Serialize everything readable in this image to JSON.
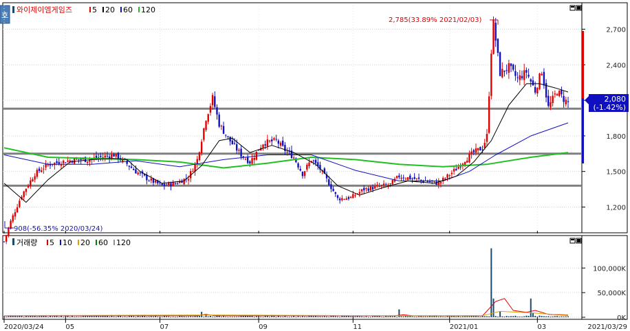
{
  "price_panel": {
    "stock_name": "와이제이엠게임즈",
    "ma_items": [
      {
        "label": "5",
        "color": "#e00000"
      },
      {
        "label": "20",
        "color": "#000000"
      },
      {
        "label": "60",
        "color": "#1010c0"
      },
      {
        "label": "120",
        "color": "#20c020"
      }
    ],
    "max_annotation": "2,785(33.89% 2021/02/03)",
    "min_annotation": "908(-56.35% 2020/03/24)",
    "current_price": "2,080",
    "current_change": "(-1.42%)",
    "side_button": "호"
  },
  "volume_panel": {
    "title": "거래량",
    "ma_items": [
      {
        "label": "5",
        "color": "#e00000"
      },
      {
        "label": "10",
        "color": "#1010c0"
      },
      {
        "label": "20",
        "color": "#e0a000"
      },
      {
        "label": "60",
        "color": "#008000"
      },
      {
        "label": "120",
        "color": "#909090"
      }
    ]
  },
  "colors": {
    "up": "#e00000",
    "down": "#1010c0",
    "ma5": "#e00000",
    "ma20": "#000000",
    "ma60": "#1010c0",
    "ma120": "#20c020",
    "hline": "#808080",
    "volume_bar": "#1a4a6e"
  },
  "chart_data": [
    {
      "type": "candlestick",
      "title": "와이제이엠게임즈",
      "y_ticks": [
        1200,
        1500,
        1800,
        2100,
        2400,
        2700
      ],
      "y_tick_labels": [
        "1,200",
        "1,500",
        "1,800",
        "2,100",
        "2,400",
        "2,700"
      ],
      "ylim": [
        1000,
        2900
      ],
      "x_ticks": [
        "2020/03/24",
        "05",
        "07",
        "09",
        "11",
        "2021/01",
        "03",
        "2021/03/29"
      ],
      "horizontal_lines": [
        2030,
        1650,
        1380
      ],
      "close_trend": [
        {
          "x": 0,
          "y": 908
        },
        {
          "x": 3,
          "y": 1080
        },
        {
          "x": 8,
          "y": 1300
        },
        {
          "x": 14,
          "y": 1480
        },
        {
          "x": 20,
          "y": 1560
        },
        {
          "x": 26,
          "y": 1580
        },
        {
          "x": 32,
          "y": 1600
        },
        {
          "x": 38,
          "y": 1600
        },
        {
          "x": 44,
          "y": 1620
        },
        {
          "x": 50,
          "y": 1640
        },
        {
          "x": 55,
          "y": 1580
        },
        {
          "x": 60,
          "y": 1500
        },
        {
          "x": 66,
          "y": 1430
        },
        {
          "x": 72,
          "y": 1380
        },
        {
          "x": 78,
          "y": 1400
        },
        {
          "x": 84,
          "y": 1450
        },
        {
          "x": 88,
          "y": 1600
        },
        {
          "x": 92,
          "y": 1950
        },
        {
          "x": 95,
          "y": 2120
        },
        {
          "x": 98,
          "y": 1900
        },
        {
          "x": 102,
          "y": 1780
        },
        {
          "x": 108,
          "y": 1640
        },
        {
          "x": 112,
          "y": 1580
        },
        {
          "x": 118,
          "y": 1740
        },
        {
          "x": 124,
          "y": 1760
        },
        {
          "x": 128,
          "y": 1680
        },
        {
          "x": 132,
          "y": 1620
        },
        {
          "x": 136,
          "y": 1480
        },
        {
          "x": 140,
          "y": 1600
        },
        {
          "x": 144,
          "y": 1520
        },
        {
          "x": 148,
          "y": 1400
        },
        {
          "x": 152,
          "y": 1270
        },
        {
          "x": 158,
          "y": 1280
        },
        {
          "x": 164,
          "y": 1350
        },
        {
          "x": 170,
          "y": 1370
        },
        {
          "x": 176,
          "y": 1390
        },
        {
          "x": 180,
          "y": 1460
        },
        {
          "x": 186,
          "y": 1440
        },
        {
          "x": 192,
          "y": 1420
        },
        {
          "x": 198,
          "y": 1400
        },
        {
          "x": 202,
          "y": 1460
        },
        {
          "x": 206,
          "y": 1520
        },
        {
          "x": 210,
          "y": 1600
        },
        {
          "x": 214,
          "y": 1660
        },
        {
          "x": 218,
          "y": 1700
        },
        {
          "x": 220,
          "y": 1800
        },
        {
          "x": 222,
          "y": 2520
        },
        {
          "x": 223,
          "y": 2750
        },
        {
          "x": 226,
          "y": 2330
        },
        {
          "x": 230,
          "y": 2380
        },
        {
          "x": 234,
          "y": 2280
        },
        {
          "x": 238,
          "y": 2340
        },
        {
          "x": 242,
          "y": 2180
        },
        {
          "x": 245,
          "y": 2350
        },
        {
          "x": 248,
          "y": 2040
        },
        {
          "x": 252,
          "y": 2180
        },
        {
          "x": 255,
          "y": 2110
        },
        {
          "x": 257,
          "y": 2080
        }
      ],
      "ma20_trend": [
        {
          "x": 0,
          "y": 1400
        },
        {
          "x": 10,
          "y": 1240
        },
        {
          "x": 20,
          "y": 1430
        },
        {
          "x": 30,
          "y": 1580
        },
        {
          "x": 40,
          "y": 1600
        },
        {
          "x": 50,
          "y": 1610
        },
        {
          "x": 56,
          "y": 1600
        },
        {
          "x": 62,
          "y": 1500
        },
        {
          "x": 72,
          "y": 1400
        },
        {
          "x": 82,
          "y": 1420
        },
        {
          "x": 90,
          "y": 1550
        },
        {
          "x": 98,
          "y": 1760
        },
        {
          "x": 104,
          "y": 1780
        },
        {
          "x": 112,
          "y": 1660
        },
        {
          "x": 122,
          "y": 1720
        },
        {
          "x": 132,
          "y": 1660
        },
        {
          "x": 142,
          "y": 1560
        },
        {
          "x": 152,
          "y": 1380
        },
        {
          "x": 162,
          "y": 1300
        },
        {
          "x": 172,
          "y": 1360
        },
        {
          "x": 184,
          "y": 1420
        },
        {
          "x": 196,
          "y": 1400
        },
        {
          "x": 206,
          "y": 1460
        },
        {
          "x": 214,
          "y": 1580
        },
        {
          "x": 222,
          "y": 1760
        },
        {
          "x": 230,
          "y": 2060
        },
        {
          "x": 238,
          "y": 2240
        },
        {
          "x": 244,
          "y": 2240
        },
        {
          "x": 252,
          "y": 2200
        },
        {
          "x": 257,
          "y": 2170
        }
      ],
      "ma60_trend": [
        {
          "x": 0,
          "y": 1640
        },
        {
          "x": 20,
          "y": 1560
        },
        {
          "x": 40,
          "y": 1560
        },
        {
          "x": 60,
          "y": 1590
        },
        {
          "x": 80,
          "y": 1540
        },
        {
          "x": 100,
          "y": 1600
        },
        {
          "x": 120,
          "y": 1640
        },
        {
          "x": 140,
          "y": 1640
        },
        {
          "x": 160,
          "y": 1510
        },
        {
          "x": 180,
          "y": 1420
        },
        {
          "x": 200,
          "y": 1420
        },
        {
          "x": 212,
          "y": 1500
        },
        {
          "x": 224,
          "y": 1640
        },
        {
          "x": 240,
          "y": 1800
        },
        {
          "x": 257,
          "y": 1910
        }
      ],
      "ma120_trend": [
        {
          "x": 0,
          "y": 1700
        },
        {
          "x": 20,
          "y": 1620
        },
        {
          "x": 40,
          "y": 1610
        },
        {
          "x": 60,
          "y": 1600
        },
        {
          "x": 80,
          "y": 1580
        },
        {
          "x": 100,
          "y": 1530
        },
        {
          "x": 120,
          "y": 1570
        },
        {
          "x": 140,
          "y": 1620
        },
        {
          "x": 160,
          "y": 1600
        },
        {
          "x": 180,
          "y": 1560
        },
        {
          "x": 200,
          "y": 1540
        },
        {
          "x": 220,
          "y": 1560
        },
        {
          "x": 240,
          "y": 1620
        },
        {
          "x": 257,
          "y": 1660
        }
      ]
    },
    {
      "type": "bar",
      "title": "거래량",
      "y_ticks": [
        0,
        50000,
        100000
      ],
      "y_tick_labels": [
        "0K",
        "50,000K",
        "100,000K"
      ],
      "ylim": [
        0,
        145000
      ],
      "baseline_volume": 2500,
      "volume_spikes": [
        {
          "x": 90,
          "y": 11000
        },
        {
          "x": 92,
          "y": 6000
        },
        {
          "x": 180,
          "y": 16000
        },
        {
          "x": 222,
          "y": 140000
        },
        {
          "x": 223,
          "y": 38000
        },
        {
          "x": 226,
          "y": 12000
        },
        {
          "x": 240,
          "y": 38000
        },
        {
          "x": 241,
          "y": 9000
        }
      ],
      "ma_trends": [
        {
          "name": "5",
          "points": [
            {
              "x": 0,
              "y": 3000
            },
            {
              "x": 88,
              "y": 3000
            },
            {
              "x": 92,
              "y": 6000
            },
            {
              "x": 96,
              "y": 3000
            },
            {
              "x": 178,
              "y": 3000
            },
            {
              "x": 182,
              "y": 5000
            },
            {
              "x": 186,
              "y": 3000
            },
            {
              "x": 218,
              "y": 3000
            },
            {
              "x": 224,
              "y": 32000
            },
            {
              "x": 228,
              "y": 38000
            },
            {
              "x": 232,
              "y": 14000
            },
            {
              "x": 238,
              "y": 10000
            },
            {
              "x": 242,
              "y": 14000
            },
            {
              "x": 248,
              "y": 6000
            },
            {
              "x": 257,
              "y": 4000
            }
          ]
        },
        {
          "name": "20",
          "points": [
            {
              "x": 0,
              "y": 3500
            },
            {
              "x": 96,
              "y": 4500
            },
            {
              "x": 180,
              "y": 3200
            },
            {
              "x": 218,
              "y": 3200
            },
            {
              "x": 226,
              "y": 12000
            },
            {
              "x": 240,
              "y": 9000
            },
            {
              "x": 250,
              "y": 6000
            },
            {
              "x": 257,
              "y": 5000
            }
          ]
        }
      ]
    }
  ]
}
